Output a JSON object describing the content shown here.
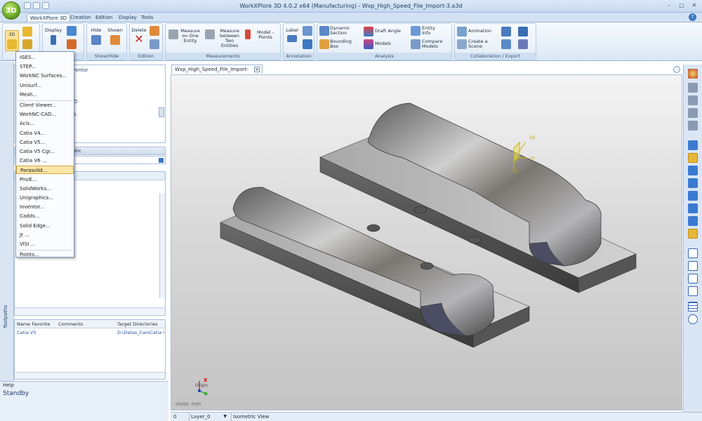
{
  "app": {
    "logo_label": "3D",
    "title": "WorkXPlore 3D 4.0.2 x64 (Manufacturing) - Wxp_High_Speed_File_Import-3.a3d"
  },
  "window_controls": {
    "minimize": "–",
    "maximize": "▢",
    "close": "✕"
  },
  "menu_tabs": [
    "WorkXPlore 3D",
    "Creation",
    "Edition",
    "Display",
    "Tools"
  ],
  "help_label": "?",
  "ribbon": {
    "file_group": {
      "btn_3d": "3D"
    },
    "display_group": {
      "display_label": "Display",
      "group_label": "n"
    },
    "showhide_group": {
      "hide_label": "Hide",
      "shown_label": "Shown",
      "group_label": "Show/Hide"
    },
    "edition_group": {
      "delete_label": "Delete",
      "group_label": "Edition"
    },
    "measurements_group": {
      "measure_one": "Measure on One Entity",
      "measure_two": "Measure between Two Entities",
      "model_points": "Model - Points",
      "group_label": "Measurements"
    },
    "annotation_group": {
      "label_label": "Label",
      "group_label": "Annotation"
    },
    "analysis_group": {
      "dynamic_section": "Dynamic Section",
      "draft_angle": "Draft Angle",
      "entity_info": "Entity Info",
      "bounding_box": "Bounding Box",
      "models": "Models",
      "compare_models": "Compare Models",
      "group_label": "Analysis"
    },
    "collab_group": {
      "animation": "Animation",
      "create_scene": "Create a Scene",
      "group_label": "Collaboration / Export"
    }
  },
  "import_menu": {
    "items": [
      "IGES...",
      "STEP...",
      "WorkNC Surfaces...",
      "Unisurf...",
      "Mesh...",
      "Client Viewer...",
      "WorkNC-CAD...",
      "Acis...",
      "Catia V4...",
      "Catia V5...",
      "Catia V5 Cgr...",
      "Catia V6 ...",
      "Parasolid...",
      "Pro/E...",
      "SolidWorks...",
      "Unigraphics...",
      "Inventor...",
      "Cadds...",
      "Solid Edge...",
      "Jt ...",
      "VISI ...",
      "Points..."
    ],
    "highlighted": "Parasolid..."
  },
  "left_panel": {
    "tree_peek": [
      "ventor",
      "D",
      "s"
    ],
    "prop_peek": "atic",
    "sidebar_tab": "Toolpaths",
    "favorites": {
      "columns": [
        "Name Favorite",
        "Comments",
        "Target Directories"
      ],
      "rows": [
        {
          "name": "Catia V5",
          "comments": "",
          "target": "D:\\Datas_Cao\\Catia V5"
        }
      ]
    },
    "help_title": "Help",
    "help_status": "Standby"
  },
  "document_tab": "Wxp_High_Speed_File_Import-3.a3d",
  "viewport": {
    "triad_labels": {
      "ox": "OX",
      "oy": "OY",
      "oz": "OZ"
    },
    "axis_x": "X",
    "axis_y": "Y",
    "origin": "Origin",
    "units": "Units: mm"
  },
  "status": {
    "field0": "0",
    "layer": "Layer_0",
    "view": "Isometric View"
  },
  "colors": {
    "ribbon_top": "#f7fafd",
    "accent": "#3d78c2",
    "highlight": "#fce6a8",
    "part_gray": "#8f8f8f"
  }
}
